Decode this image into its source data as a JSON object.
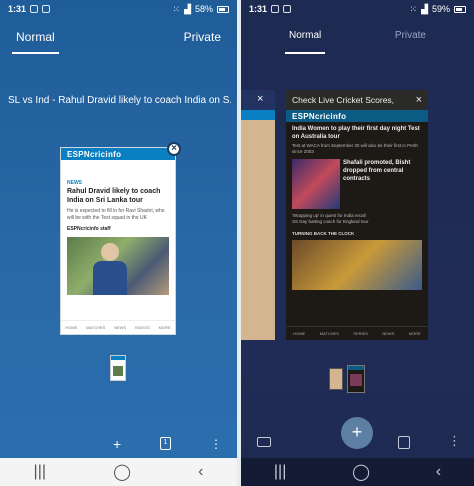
{
  "left": {
    "status": {
      "time": "1:31",
      "battery": "58%"
    },
    "tabs": [
      "Normal",
      "Private"
    ],
    "headline": "SL vs Ind - Rahul Dravid likely to coach India on S...",
    "card": {
      "brand": "ESPNcricinfo",
      "tag": "NEWS",
      "title": "Rahul Dravid likely to coach India on Sri Lanka tour",
      "desc": "He is expected to fill in for Ravi Shastri, who will be with the Test squad in the UK",
      "byline": "ESPNcricinfo staff",
      "nav": [
        "HOME",
        "MATCHES",
        "NEWS",
        "VIDEOS",
        "MORE"
      ]
    },
    "actions": {
      "add": "+",
      "tabs_count": "1",
      "more": "⋮"
    },
    "navbar": [
      "|||",
      "◯",
      "‹"
    ]
  },
  "right": {
    "status": {
      "time": "1:31",
      "battery": "59%"
    },
    "tabs": [
      "Normal",
      "Private"
    ],
    "card_title": "Check Live Cricket Scores,",
    "card": {
      "brand": "ESPNcricinfo",
      "headline1": "India Women to play their first day night Test on Australia tour",
      "desc1": "Test at WACA from September 30 will also be their first in Perth since 2003",
      "headline2": "Shafali promoted, Bisht dropped from central contracts",
      "list": [
        "'Wrapping up' in quest for India recall",
        "SS Day batting coach for England tour"
      ],
      "section": "TURNING BACK THE CLOCK",
      "nav": [
        "HOME",
        "MATCHES",
        "SERIES",
        "NEWS",
        "MORE"
      ]
    },
    "navbar": [
      "|||",
      "◯",
      "‹"
    ]
  }
}
